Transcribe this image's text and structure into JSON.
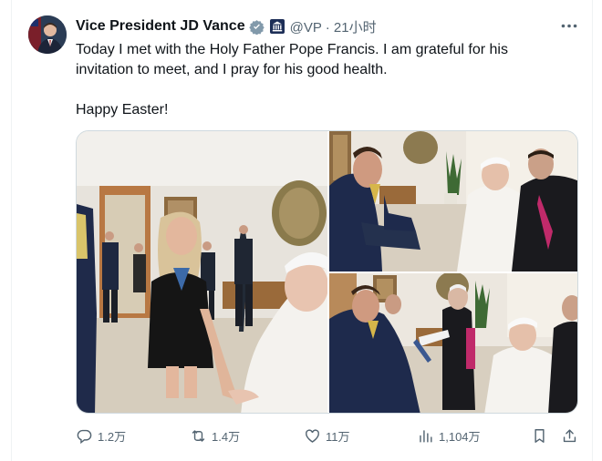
{
  "tweet": {
    "author_name": "Vice President JD Vance",
    "handle_time": "@VP · 21小时",
    "text_line1": "Today I met with the Holy Father Pope Francis. I am grateful for his invitation to meet, and I pray for his good health.",
    "text_line2": "Happy Easter!",
    "icons": {
      "verified": "verified-badge-icon",
      "affiliation": "government-building-icon",
      "more": "more-options-icon"
    },
    "colors": {
      "verified": "#829aab",
      "secondary_text": "#536471"
    }
  },
  "actions": {
    "replies": "1.2万",
    "retweets": "1.4万",
    "likes": "11万",
    "views": "1,104万"
  }
}
